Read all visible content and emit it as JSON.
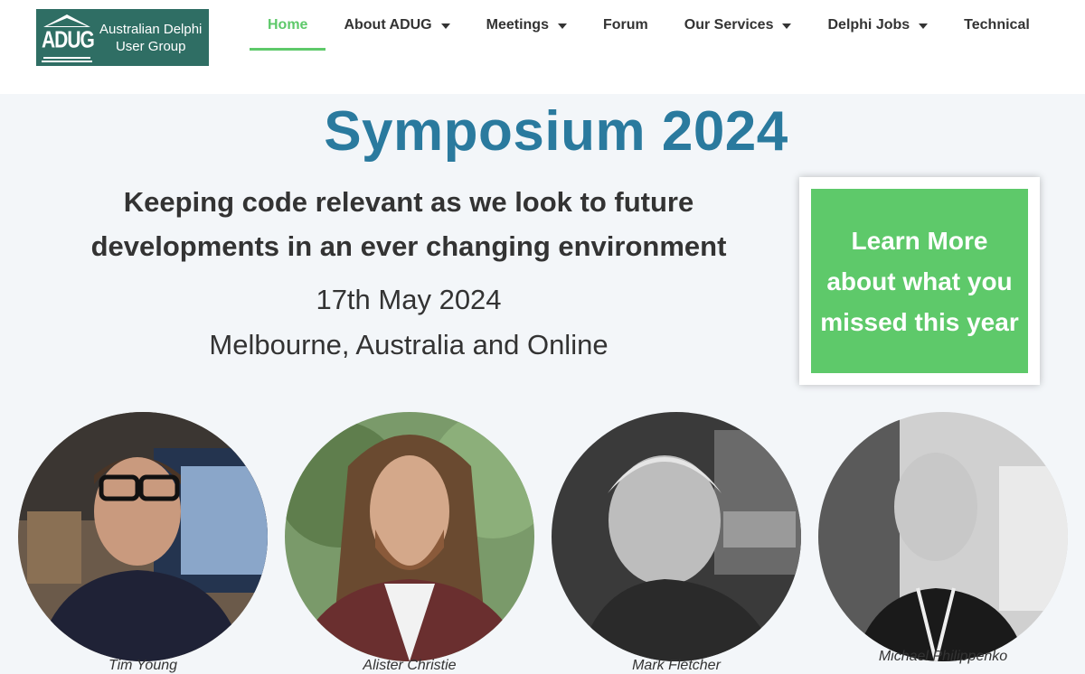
{
  "logo": {
    "mark_text": "ADUG",
    "line1": "Australian Delphi",
    "line2": "User Group"
  },
  "nav": {
    "items": [
      {
        "label": "Home",
        "active": true,
        "dropdown": false
      },
      {
        "label": "About ADUG",
        "dropdown": true
      },
      {
        "label": "Meetings",
        "dropdown": true
      },
      {
        "label": "Forum",
        "dropdown": false
      },
      {
        "label": "Our Services",
        "dropdown": true
      },
      {
        "label": "Delphi Jobs",
        "dropdown": true
      },
      {
        "label": "Technical",
        "dropdown": false
      }
    ]
  },
  "hero": {
    "title": "Symposium 2024",
    "tagline": "Keeping code relevant as we look to future developments in an ever changing environment",
    "date": "17th May 2024",
    "location": "Melbourne, Australia and Online"
  },
  "cta": {
    "label": "Learn More about what you missed this year"
  },
  "speakers": [
    {
      "name": "Tim Young"
    },
    {
      "name": "Alister Christie"
    },
    {
      "name": "Mark Fletcher"
    },
    {
      "name": "Michael Philippenko"
    }
  ],
  "colors": {
    "accent_green": "#5ec96a",
    "title_blue": "#2a7a9e",
    "logo_bg": "#2f6e64",
    "page_bg": "#f3f6f9"
  }
}
